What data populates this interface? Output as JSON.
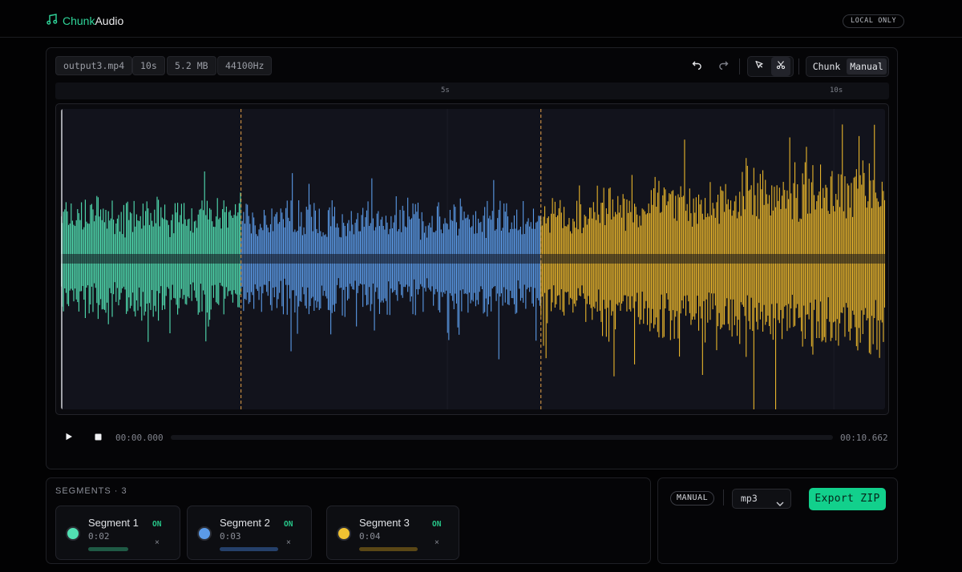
{
  "app": {
    "name_accent": "Chunk",
    "name_rest": "Audio",
    "badge": "LOCAL ONLY"
  },
  "file": {
    "name": "output3.mp4",
    "duration": "10s",
    "size": "5.2 MB",
    "sample_rate": "44100Hz"
  },
  "toolbar": {
    "undo_icon": "undo-icon",
    "redo_icon": "redo-icon",
    "select_icon": "cursor-icon",
    "cut_icon": "scissors-icon"
  },
  "modes": {
    "chunk": "Chunk",
    "manual": "Manual",
    "active": "Manual"
  },
  "ruler": {
    "mark_5": "5s",
    "mark_10": "10s"
  },
  "waveform": {
    "cut_markers_seconds": [
      2.33,
      6.21
    ],
    "total_seconds": 10.662,
    "segment_colors": [
      "#52e0b3",
      "#5b9be8",
      "#e8b52c"
    ]
  },
  "transport": {
    "current_time": "00:00.000",
    "total_time": "00:10.662",
    "progress": 0
  },
  "segments": {
    "title": "SEGMENTS · 3",
    "items": [
      {
        "name": "Segment 1",
        "duration": "0:02",
        "status": "ON",
        "color": "#52e0b3",
        "bar_color": "#1f5a45"
      },
      {
        "name": "Segment 2",
        "duration": "0:03",
        "status": "ON",
        "color": "#5b9be8",
        "bar_color": "#25406a"
      },
      {
        "name": "Segment 3",
        "duration": "0:04",
        "status": "ON",
        "color": "#f0c232",
        "bar_color": "#5a4716"
      }
    ]
  },
  "export": {
    "mode_tag": "MANUAL",
    "format": "mp3",
    "button": "Export ZIP"
  }
}
